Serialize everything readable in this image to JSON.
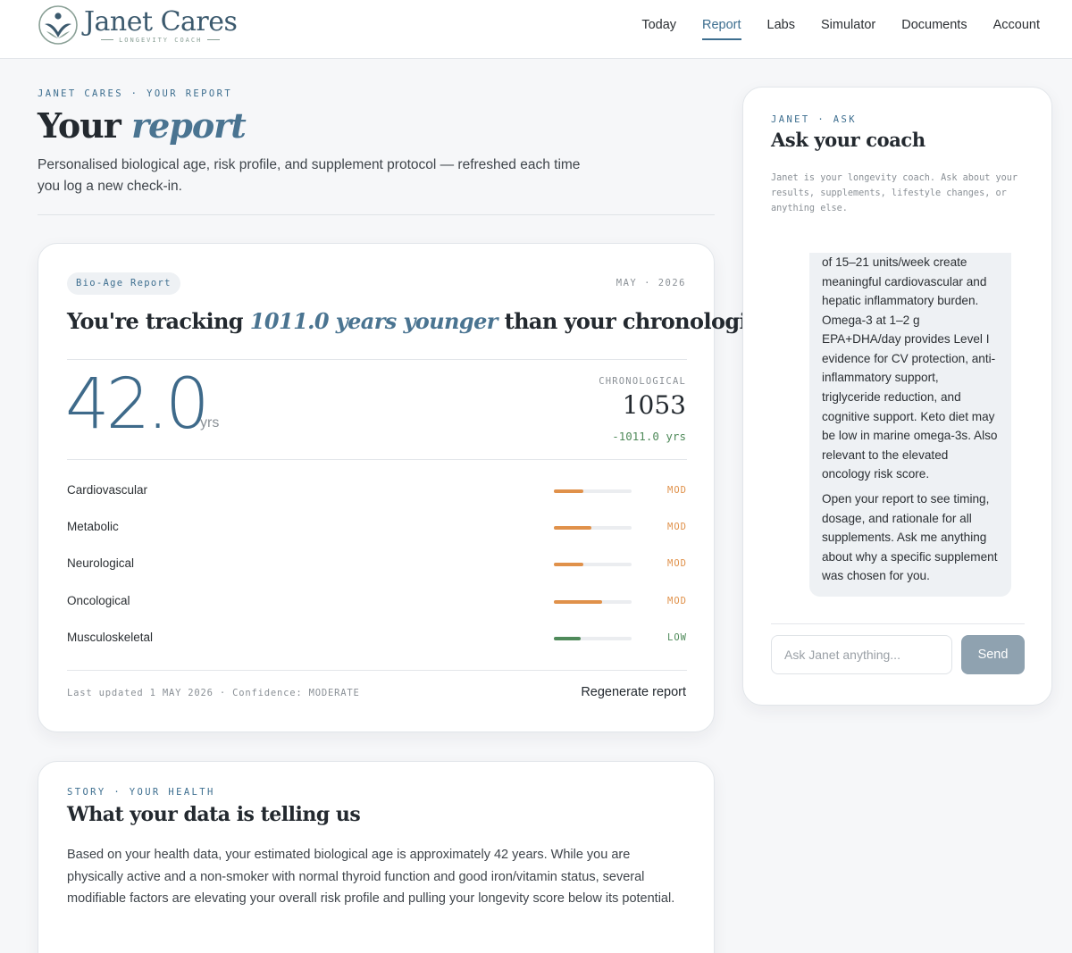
{
  "brand": {
    "name": "Janet Cares",
    "tagline": "LONGEVITY COACH"
  },
  "nav": {
    "items": [
      {
        "label": "Today",
        "active": false
      },
      {
        "label": "Report",
        "active": true
      },
      {
        "label": "Labs",
        "active": false
      },
      {
        "label": "Simulator",
        "active": false
      },
      {
        "label": "Documents",
        "active": false
      },
      {
        "label": "Account",
        "active": false
      }
    ]
  },
  "page": {
    "eyebrow": "JANET CARES · YOUR REPORT",
    "title_plain": "Your",
    "title_emph": "report",
    "subtitle": "Personalised biological age, risk profile, and supplement protocol — refreshed each time you log a new check-in."
  },
  "report": {
    "badge": "Bio-Age Report",
    "date": "MAY · 2026",
    "headline_pre": "You're tracking",
    "headline_emph": "1011.0 years younger",
    "headline_post": "than your chronological age.",
    "bio_age": "42.0",
    "bio_age_unit": "yrs",
    "chrono_label": "CHRONOLOGICAL",
    "chrono_value": "1053",
    "chrono_diff": "-1011.0 yrs",
    "risks": [
      {
        "name": "Cardiovascular",
        "level": "MOD",
        "fill": 0.38,
        "color": "#e0914a"
      },
      {
        "name": "Metabolic",
        "level": "MOD",
        "fill": 0.48,
        "color": "#e0914a"
      },
      {
        "name": "Neurological",
        "level": "MOD",
        "fill": 0.38,
        "color": "#e0914a"
      },
      {
        "name": "Oncological",
        "level": "MOD",
        "fill": 0.62,
        "color": "#e0914a"
      },
      {
        "name": "Musculoskeletal",
        "level": "LOW",
        "fill": 0.35,
        "color": "#4f8a5a"
      }
    ],
    "footer_meta": "Last updated 1 MAY 2026 · Confidence: MODERATE",
    "regenerate_label": "Regenerate report"
  },
  "story": {
    "eyebrow": "STORY · YOUR HEALTH",
    "title": "What your data is telling us",
    "body": "Based on your health data, your estimated biological age is approximately 42 years. While you are physically active and a non-smoker with normal thyroid function and good iron/vitamin status, several modifiable factors are elevating your overall risk profile and pulling your longevity score below its potential."
  },
  "chat": {
    "eyebrow": "JANET · ASK",
    "title": "Ask your coach",
    "intro": "Janet is your longevity coach. Ask about your results, supplements, lifestyle changes, or anything else.",
    "message_p1": "of 15–21 units/week create meaningful cardiovascular and hepatic inflammatory burden. Omega-3 at 1–2 g EPA+DHA/day provides Level I evidence for CV protection, anti-inflammatory support, triglyceride reduction, and cognitive support. Keto diet may be low in marine omega-3s. Also relevant to the elevated oncology risk score.",
    "message_p2": "Open your report to see timing, dosage, and rationale for all supplements. Ask me anything about why a specific supplement was chosen for you.",
    "input_placeholder": "Ask Janet anything...",
    "send_label": "Send"
  },
  "colors": {
    "accent": "#3d6e8f",
    "moderate": "#e0914a",
    "low": "#4f8a5a",
    "send_button": "#8fa2b0"
  },
  "icons": {
    "logo": "person-leaf-logo-icon"
  }
}
